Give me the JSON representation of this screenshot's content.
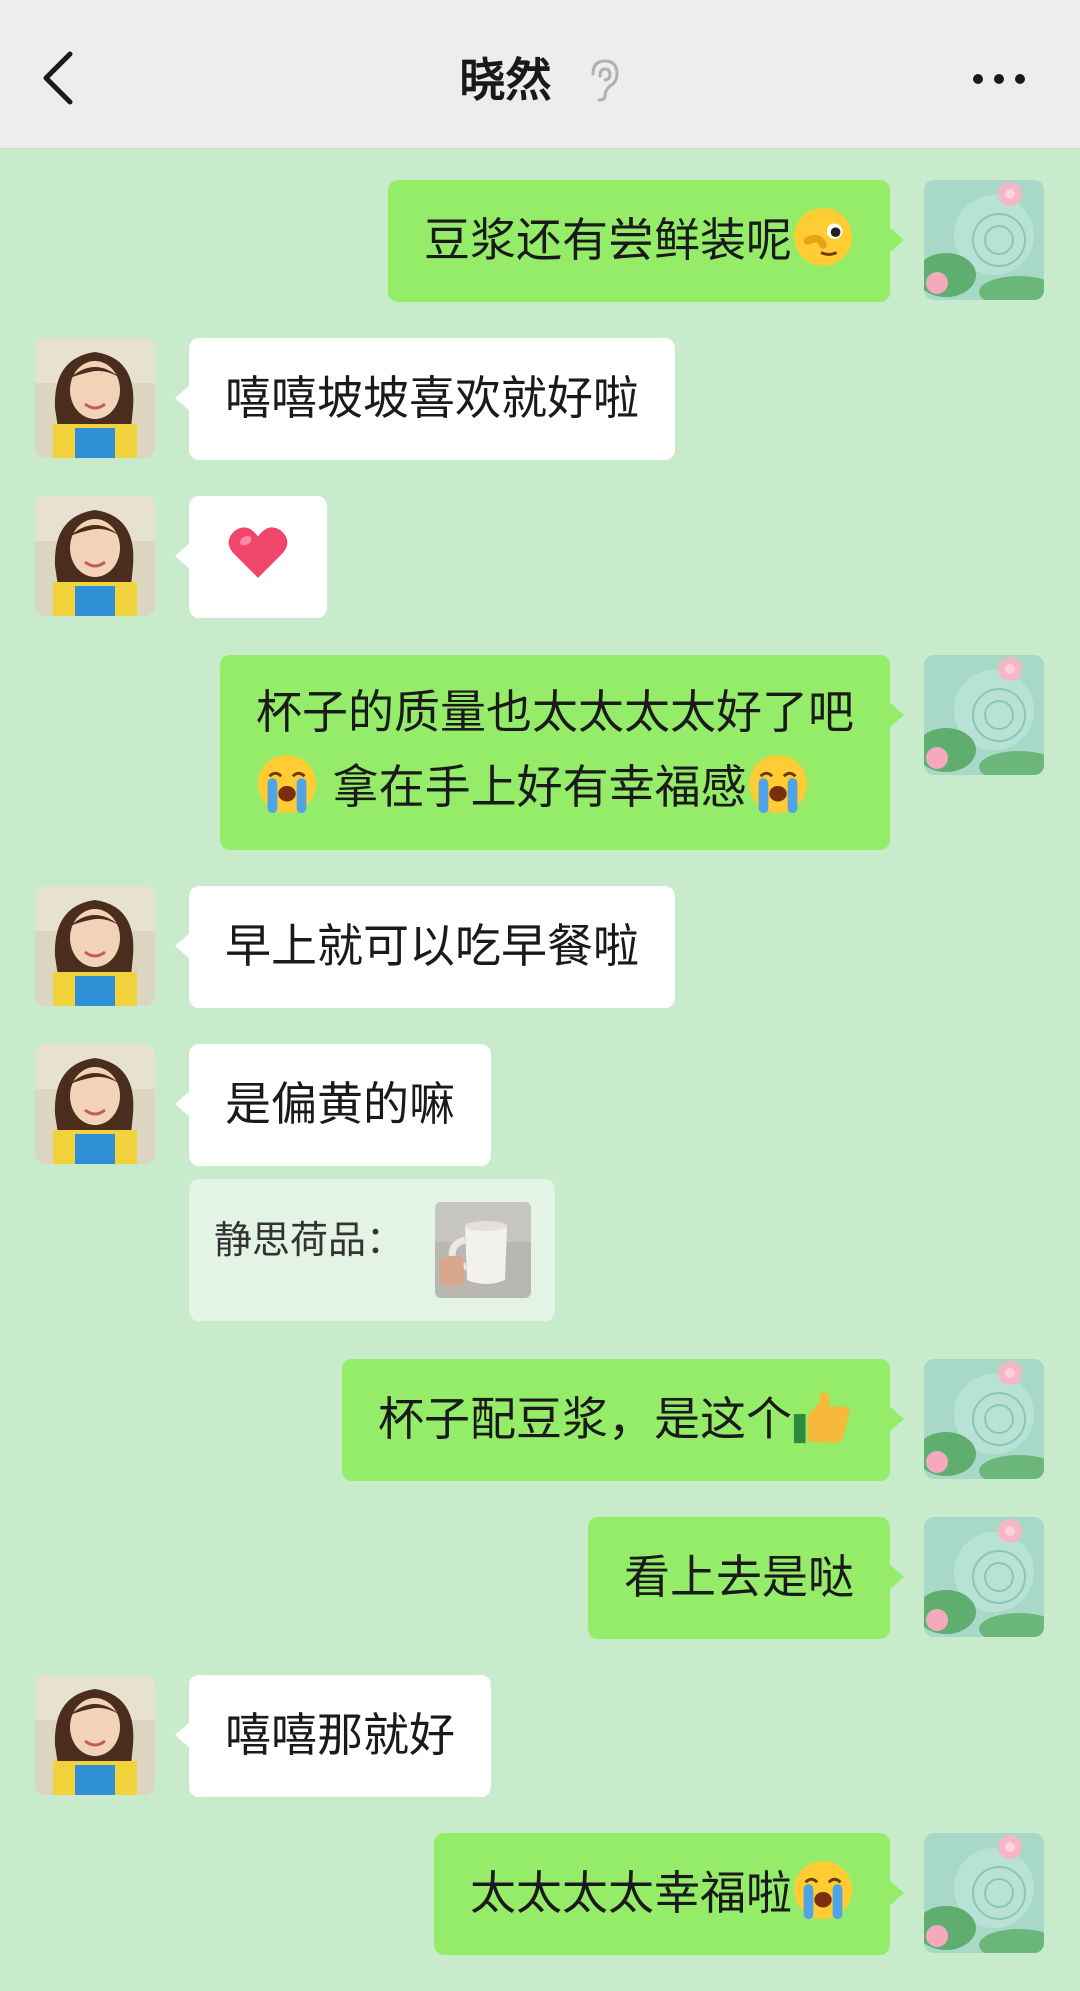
{
  "header": {
    "title": "晓然",
    "back_icon": "chevron-left-icon",
    "ear_icon": "ear-icon",
    "more_icon": "more-icon"
  },
  "colors": {
    "bg": "#c7ebcb",
    "my_bubble": "#95ec69",
    "her_bubble": "#ffffff",
    "header": "#ededed"
  },
  "messages": [
    {
      "from": "me",
      "text": "豆浆还有尝鲜装呢",
      "emoji": "wink-emoji"
    },
    {
      "from": "her",
      "text": "嘻嘻坡坡喜欢就好啦"
    },
    {
      "from": "her",
      "text": "",
      "emoji": "heart-emoji"
    },
    {
      "from": "me",
      "line1": "杯子的质量也太太太太好了吧",
      "line2": "拿在手上好有幸福感",
      "emoji": "crying-emoji"
    },
    {
      "from": "her",
      "text": "早上就可以吃早餐啦"
    },
    {
      "from": "her",
      "text": "是偏黄的嘛"
    },
    {
      "from": "me",
      "text": "杯子配豆浆，是这个",
      "emoji": "thumbs-up-emoji"
    },
    {
      "from": "me",
      "text": "看上去是哒"
    },
    {
      "from": "her",
      "text": "嘻嘻那就好"
    },
    {
      "from": "me",
      "text": "太太太太幸福啦",
      "emoji": "crying-emoji"
    }
  ],
  "quote": {
    "label": "静思荷品：",
    "image": "mug-photo"
  }
}
